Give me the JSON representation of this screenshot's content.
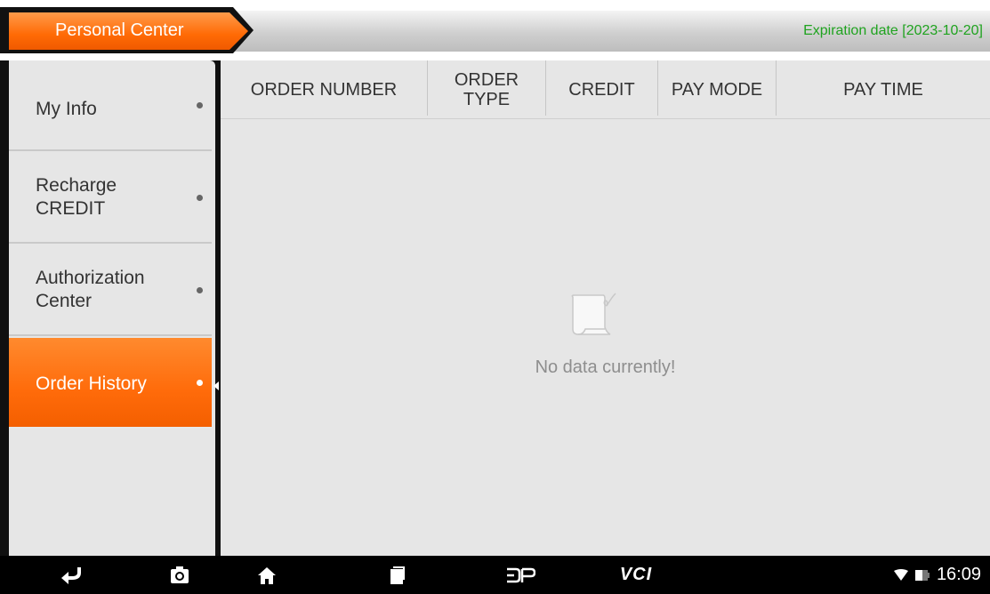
{
  "header": {
    "title": "Personal Center",
    "expiration": "Expiration date [2023-10-20]"
  },
  "sidebar": {
    "items": [
      {
        "label": "My Info"
      },
      {
        "label": "Recharge CREDIT"
      },
      {
        "label": "Authorization Center"
      },
      {
        "label": "Order History",
        "active": true
      }
    ]
  },
  "table": {
    "columns": [
      {
        "label": "ORDER NUMBER"
      },
      {
        "label": "ORDER TYPE"
      },
      {
        "label": "CREDIT"
      },
      {
        "label": "PAY MODE"
      },
      {
        "label": "PAY TIME"
      }
    ],
    "rows": [],
    "empty_message": "No data currently!"
  },
  "navbar": {
    "icons": [
      "back-icon",
      "camera-icon",
      "home-icon",
      "recent-apps-icon",
      "dp-logo-icon",
      "vci-icon"
    ],
    "vci_label": "VCI",
    "clock": "16:09"
  },
  "colors": {
    "accent": "#ff6b0a",
    "expiration": "#1fa31f"
  }
}
